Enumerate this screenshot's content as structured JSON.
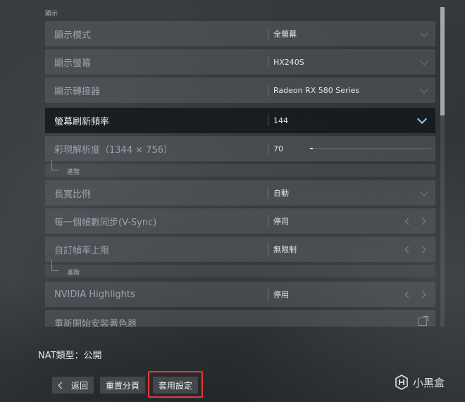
{
  "section_header": "顯示",
  "rows": [
    {
      "label": "顯示模式",
      "value": "全螢幕",
      "control": "dropdown"
    },
    {
      "label": "顯示螢幕",
      "value": "HX240S",
      "control": "dropdown"
    },
    {
      "label": "顯示轉接器",
      "value": "Radeon RX 580 Series",
      "control": "dropdown"
    },
    {
      "label": "螢幕刷新頻率",
      "value": "144",
      "control": "dropdown",
      "selected": true
    },
    {
      "label": "彩現解析度（1344 × 756）",
      "value": "70",
      "control": "slider",
      "slider_fraction": 0.02
    },
    {
      "label": "長寬比例",
      "value": "自動",
      "control": "dropdown"
    },
    {
      "label": "每一個幀數同步(V-Sync)",
      "value": "停用",
      "control": "arrows"
    },
    {
      "label": "自訂幀率上限",
      "value": "無限制",
      "control": "arrows"
    },
    {
      "label": "NVIDIA Highlights",
      "value": "停用",
      "control": "arrows"
    },
    {
      "label": "重新開始安裝著色器",
      "value": "",
      "control": "external"
    }
  ],
  "advanced_label": "進階",
  "scrollbar_fraction": 0.34,
  "nat_text": "NAT類型：公開",
  "footer": {
    "back": "返回",
    "reset": "重置分頁",
    "apply": "套用設定"
  },
  "watermark": "小黑盒",
  "colors": {
    "accent": "#8ecbf0",
    "highlight": "#e23a3a"
  }
}
